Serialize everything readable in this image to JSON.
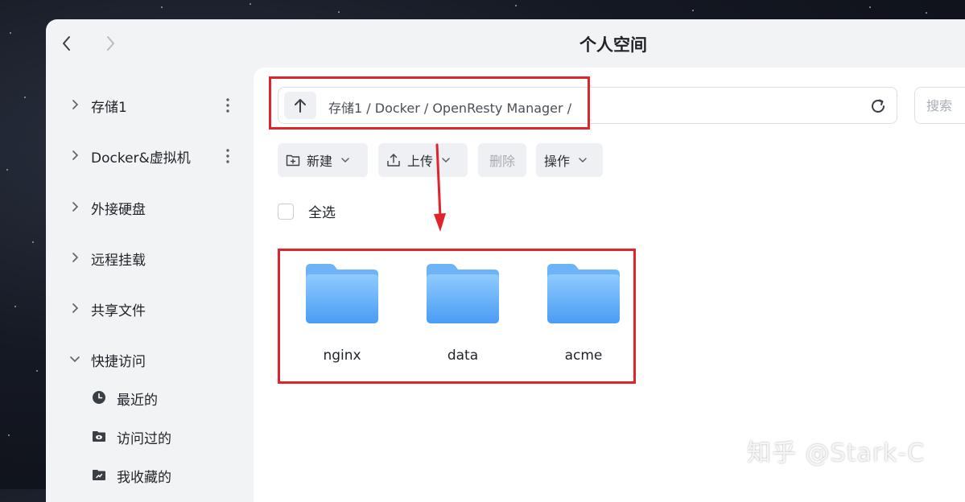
{
  "window": {
    "title": "个人空间"
  },
  "sidebar": {
    "items": [
      {
        "label": "存储1",
        "expanded": false,
        "has_more": true
      },
      {
        "label": "Docker&虚拟机",
        "expanded": false,
        "has_more": true
      },
      {
        "label": "外接硬盘",
        "expanded": false,
        "has_more": false
      },
      {
        "label": "远程挂载",
        "expanded": false,
        "has_more": false
      },
      {
        "label": "共享文件",
        "expanded": false,
        "has_more": false
      },
      {
        "label": "快捷访问",
        "expanded": true,
        "has_more": false
      }
    ],
    "quick_access": [
      {
        "label": "最近的",
        "icon": "clock-icon"
      },
      {
        "label": "访问过的",
        "icon": "eye-folder-icon"
      },
      {
        "label": "我收藏的",
        "icon": "star-folder-icon"
      }
    ]
  },
  "pathbar": {
    "path": "存储1 / Docker / OpenResty Manager /"
  },
  "search": {
    "placeholder": "搜索"
  },
  "toolbar": {
    "new_label": "新建",
    "upload_label": "上传",
    "delete_label": "删除",
    "actions_label": "操作"
  },
  "selection": {
    "select_all_label": "全选"
  },
  "files": [
    {
      "name": "nginx",
      "type": "folder"
    },
    {
      "name": "data",
      "type": "folder"
    },
    {
      "name": "acme",
      "type": "folder"
    }
  ],
  "colors": {
    "highlight": "#e0242b",
    "folder_top": "#7cc1fb",
    "folder_bottom": "#4a9cf4"
  },
  "watermark": {
    "text": "知乎 @Stark-C"
  }
}
